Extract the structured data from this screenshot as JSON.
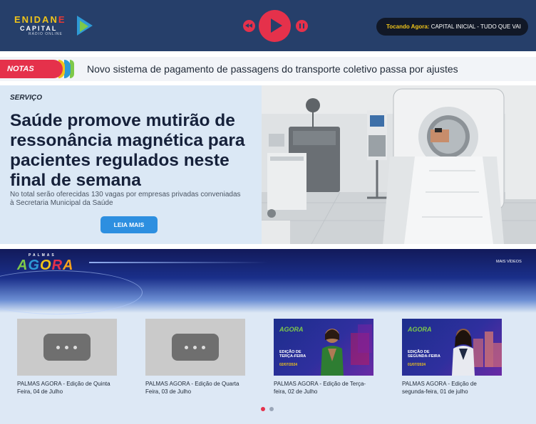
{
  "header": {
    "logo": {
      "line1_a": "ENIDAN",
      "line1_b": "E",
      "line2": "CAPITAL",
      "line3": "RÁDIO ONLINE"
    },
    "now_playing": {
      "label": "Tocando Agora:",
      "text": "CAPITAL INICIAL - TUDO QUE VAI"
    }
  },
  "ticker": {
    "badge": "NOTAS",
    "text": "Novo sistema de pagamento de passagens do transporte coletivo passa por ajustes"
  },
  "hero": {
    "category": "SERVIÇO",
    "title": "Saúde promove mutirão de ressonância magnética para pacientes regulados neste final de semana",
    "description": "No total serão oferecidas 130 vagas por empresas privadas conveniadas à Secretaria Municipal da Saúde",
    "button": "LEIA MAIS"
  },
  "videos": {
    "brand_small": "PALMAS",
    "brand_parts": [
      "A",
      "G",
      "O",
      "R",
      "A"
    ],
    "more_label": "MAIS VÍDEOS",
    "items": [
      {
        "caption": "PALMAS AGORA - Edição de Quinta Feira, 04 de Julho"
      },
      {
        "caption": "PALMAS AGORA - Edição de Quarta Feira, 03 de Julho"
      },
      {
        "caption": "PALMAS AGORA - Edição de Terça-feira, 02 de Julho",
        "thumb_logo_a": "AGO",
        "thumb_logo_b": "RA",
        "thumb_title_1": "EDIÇÃO DE",
        "thumb_title_2": "TERÇA-FEIRA",
        "thumb_date": "02/07/2024"
      },
      {
        "caption": "PALMAS AGORA - Edição de segunda-feira, 01 de julho",
        "thumb_logo_a": "AGO",
        "thumb_logo_b": "RA",
        "thumb_title_1": "EDIÇÃO DE",
        "thumb_title_2": "SEGUNDA-FEIRA",
        "thumb_date": "01/07/2024"
      }
    ]
  },
  "colors": {
    "header_bg": "#263f6a",
    "accent_red": "#e5314b",
    "accent_blue": "#2d8fe0",
    "hero_bg": "#dbe8f5"
  }
}
